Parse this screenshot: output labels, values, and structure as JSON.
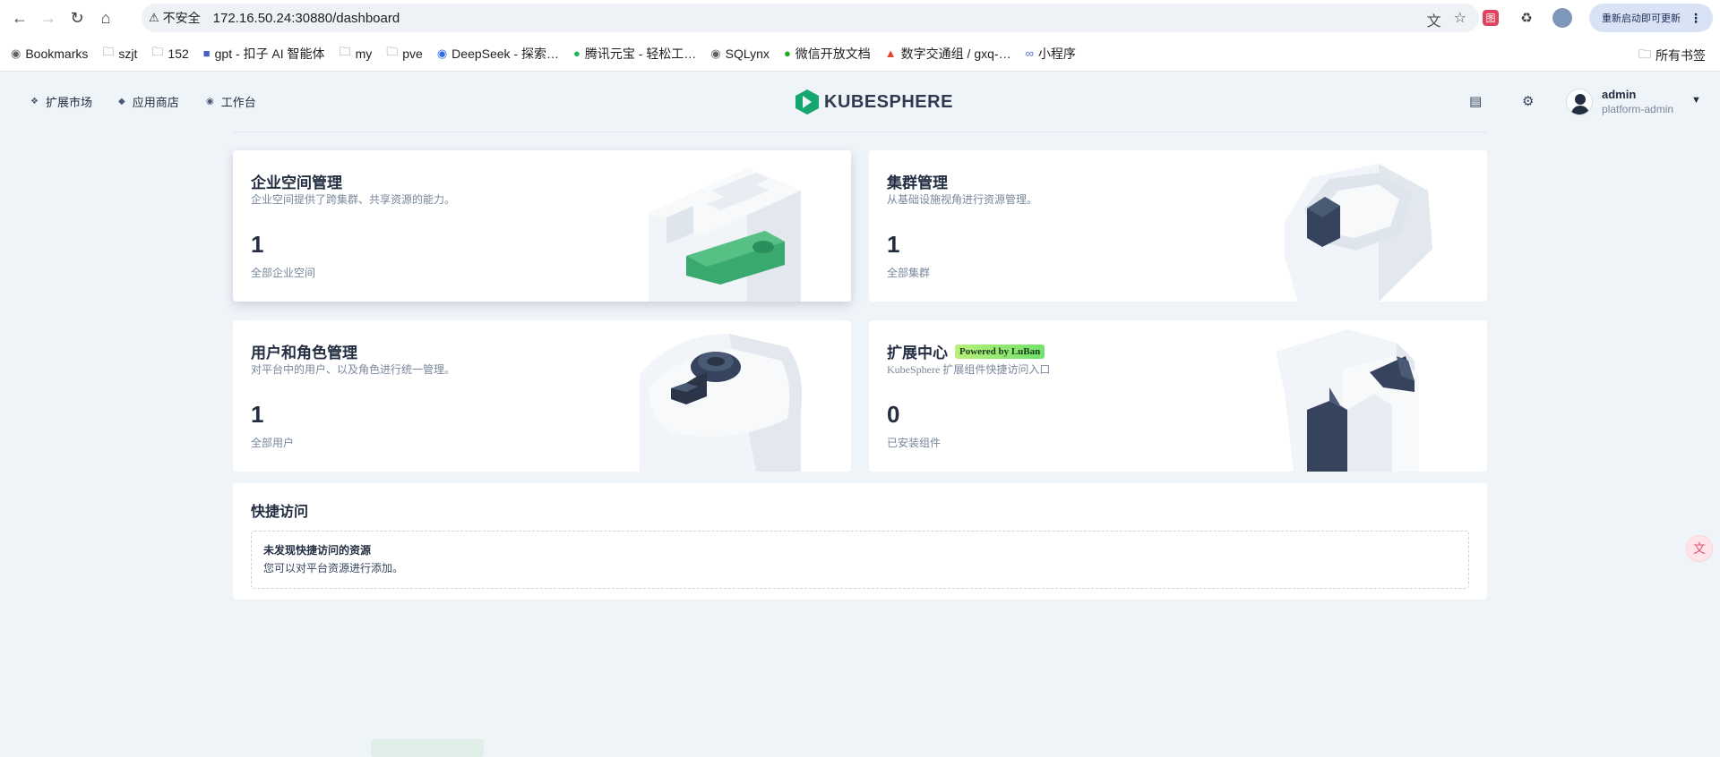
{
  "browser": {
    "insecure_label": "不安全",
    "url": "172.16.50.24:30880/dashboard",
    "update_label": "重新启动即可更新",
    "bookmarks": [
      {
        "label": "Bookmarks",
        "icon": "globe-icon"
      },
      {
        "label": "szjt",
        "icon": "folder-icon"
      },
      {
        "label": "152",
        "icon": "folder-icon"
      },
      {
        "label": "gpt - 扣子 AI 智能体",
        "icon": "coze-icon"
      },
      {
        "label": "my",
        "icon": "folder-icon"
      },
      {
        "label": "pve",
        "icon": "folder-icon"
      },
      {
        "label": "DeepSeek - 探索…",
        "icon": "deepseek-icon"
      },
      {
        "label": "腾讯元宝 - 轻松工…",
        "icon": "yuanbao-icon"
      },
      {
        "label": "SQLynx",
        "icon": "globe-icon"
      },
      {
        "label": "微信开放文档",
        "icon": "wechat-icon"
      },
      {
        "label": "数字交通组 / gxq-…",
        "icon": "gitlab-icon"
      },
      {
        "label": "小程序",
        "icon": "miniprogram-icon"
      }
    ],
    "all_bookmarks_label": "所有书签"
  },
  "header": {
    "nav": [
      {
        "label": "扩展市场"
      },
      {
        "label": "应用商店"
      },
      {
        "label": "工作台"
      }
    ],
    "logo_text": "KUBESPHERE",
    "user": {
      "name": "admin",
      "role": "platform-admin"
    }
  },
  "cards": {
    "workspace": {
      "title": "企业空间管理",
      "desc": "企业空间提供了跨集群、共享资源的能力。",
      "count": "1",
      "sub": "全部企业空间"
    },
    "cluster": {
      "title": "集群管理",
      "desc": "从基础设施视角进行资源管理。",
      "count": "1",
      "sub": "全部集群"
    },
    "users": {
      "title": "用户和角色管理",
      "desc": "对平台中的用户、以及角色进行统一管理。",
      "count": "1",
      "sub": "全部用户"
    },
    "extensions": {
      "title": "扩展中心",
      "badge": "Powered by LuBan",
      "desc": "KubeSphere 扩展组件快捷访问入口",
      "count": "0",
      "sub": "已安装组件"
    }
  },
  "quick_access": {
    "title": "快捷访问",
    "empty_title": "未发现快捷访问的资源",
    "empty_desc": "您可以对平台资源进行添加。"
  },
  "colors": {
    "brand_green": "#16a66f",
    "page_bg": "#eff4f9",
    "text_dark": "#242e42",
    "text_muted": "#79879c"
  }
}
